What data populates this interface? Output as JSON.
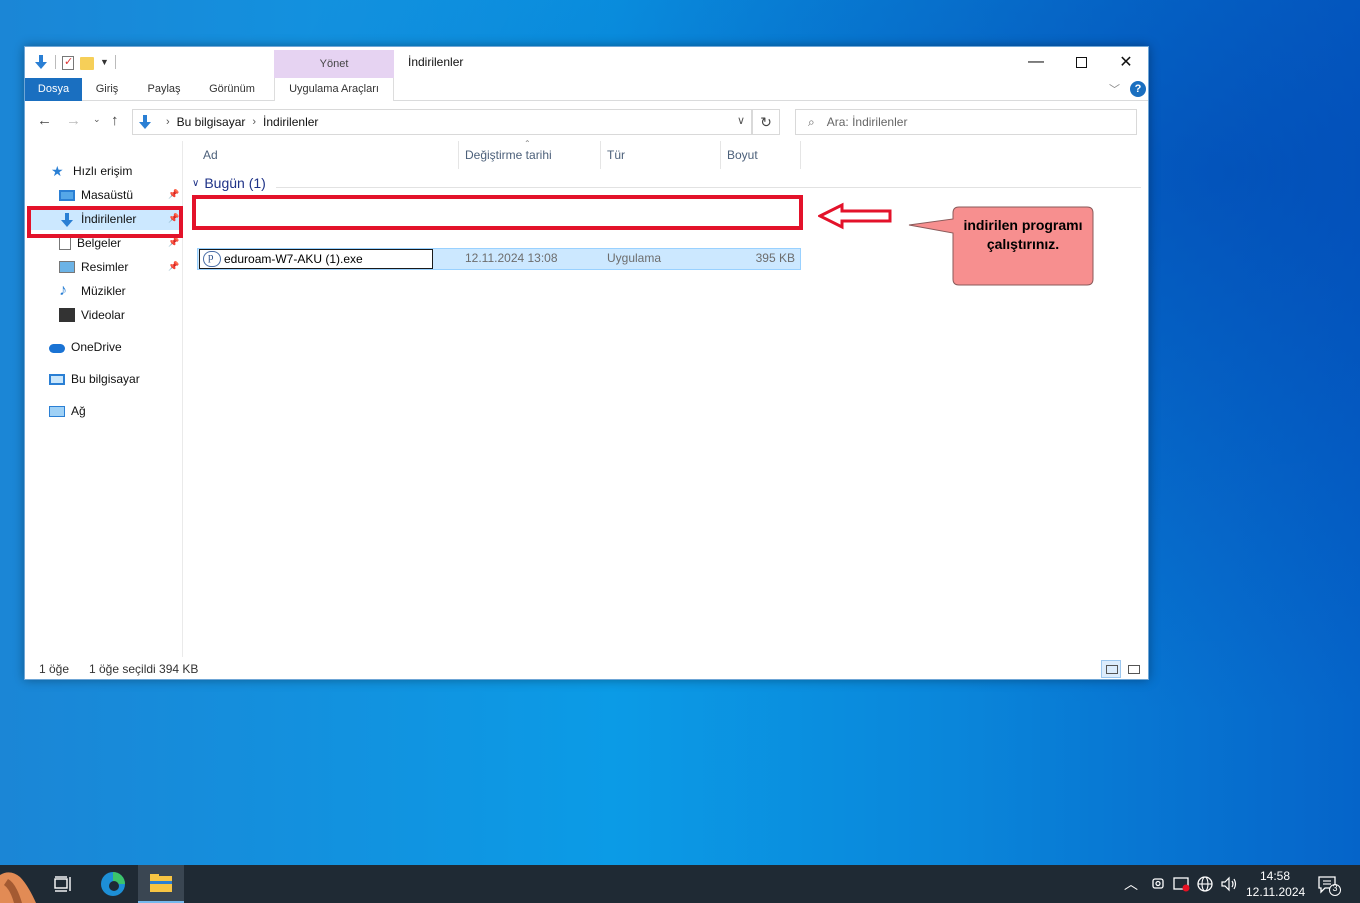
{
  "window": {
    "title": "İndirilenler",
    "contextual_group": "Yönet"
  },
  "ribbon": {
    "tabs": [
      "Dosya",
      "Giriş",
      "Paylaş",
      "Görünüm",
      "Uygulama Araçları"
    ]
  },
  "address": {
    "crumbs": [
      "Bu bilgisayar",
      "İndirilenler"
    ],
    "search_placeholder": "Ara: İndirilenler"
  },
  "navpane": {
    "quick_access": "Hızlı erişim",
    "items": [
      "Masaüstü",
      "İndirilenler",
      "Belgeler",
      "Resimler",
      "Müzikler",
      "Videolar"
    ],
    "onedrive": "OneDrive",
    "this_pc": "Bu bilgisayar",
    "network": "Ağ"
  },
  "columns": {
    "name": "Ad",
    "date": "Değiştirme tarihi",
    "type": "Tür",
    "size": "Boyut"
  },
  "group": {
    "label": "Bugün (1)"
  },
  "files": [
    {
      "name": "eduroam-W7-AKU (1).exe",
      "date": "12.11.2024 13:08",
      "type": "Uygulama",
      "size": "395 KB"
    }
  ],
  "status": {
    "count": "1 öğe",
    "selection": "1 öğe seçildi  394 KB"
  },
  "annotation": {
    "callout_text": "indirilen programı çalıştırınız.",
    "highlight_color": "#e3122a",
    "callout_color": "#f78f8f"
  },
  "taskbar": {
    "time": "14:58",
    "date": "12.11.2024",
    "notification_count": "3"
  }
}
